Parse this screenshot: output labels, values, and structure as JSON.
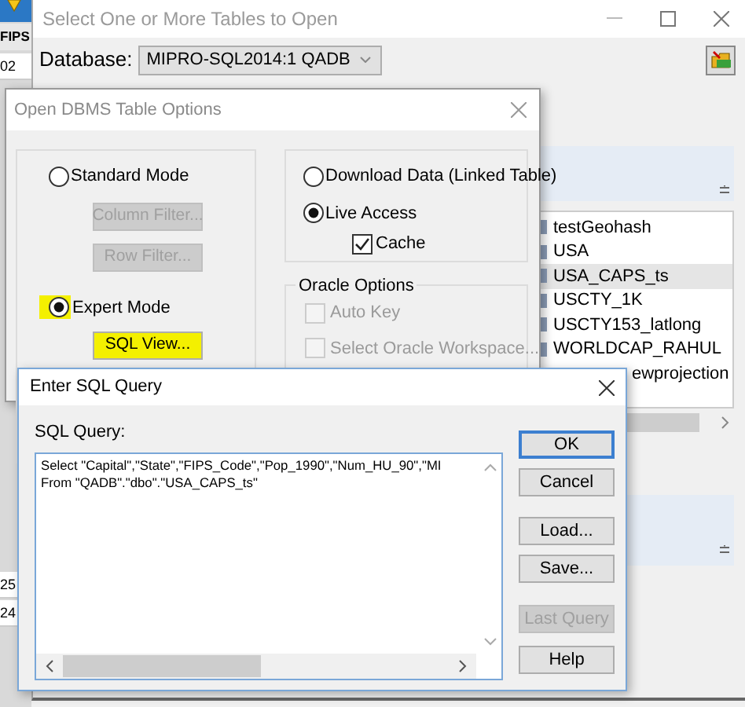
{
  "background_app": {
    "column_header": "FIPS",
    "cells": [
      "02",
      "25",
      "24"
    ]
  },
  "tables_window": {
    "title": "Select One or More Tables to Open",
    "database_label": "Database:",
    "database": "MIPRO-SQL2014:1 QADB",
    "tables": [
      {
        "name": "testGeohash",
        "selected": false
      },
      {
        "name": "USA",
        "selected": false
      },
      {
        "name": "USA_CAPS_ts",
        "selected": true
      },
      {
        "name": "USCTY_1K",
        "selected": false
      },
      {
        "name": "USCTY153_latlong",
        "selected": false
      },
      {
        "name": "WORLDCAP_RAHUL",
        "selected": false
      },
      {
        "name": "ewprojection",
        "selected": false,
        "kind": "covered"
      }
    ]
  },
  "options_dialog": {
    "title": "Open DBMS Table Options",
    "modes": [
      {
        "label": "Standard Mode",
        "selected": false,
        "highlighted": false
      },
      {
        "label": "Expert Mode",
        "selected": true,
        "highlighted": true
      }
    ],
    "mode_buttons": [
      {
        "label": "Column Filter...",
        "disabled": true,
        "highlighted": false
      },
      {
        "label": "Row Filter...",
        "disabled": true,
        "highlighted": false
      },
      {
        "label": "SQL View...",
        "disabled": false,
        "highlighted": true
      }
    ],
    "access": [
      {
        "label": "Download Data (Linked Table)",
        "selected": false
      },
      {
        "label": "Live Access",
        "selected": true
      }
    ],
    "cache": {
      "label": "Cache",
      "checked": true
    },
    "oracle_options": {
      "title": "Oracle Options",
      "items": [
        {
          "label": "Auto Key",
          "checked": false,
          "disabled": true
        },
        {
          "label": "Select Oracle Workspace...",
          "checked": false,
          "disabled": true
        }
      ]
    }
  },
  "sql_dialog": {
    "title": "Enter SQL Query",
    "label": "SQL Query:",
    "query": "Select \"Capital\",\"State\",\"FIPS_Code\",\"Pop_1990\",\"Num_HU_90\",\"MI\nFrom \"QADB\".\"dbo\".\"USA_CAPS_ts\"",
    "buttons": [
      {
        "label": "OK",
        "default": true,
        "disabled": false
      },
      {
        "label": "Cancel",
        "default": false,
        "disabled": false
      },
      {
        "label": "Load...",
        "default": false,
        "disabled": false
      },
      {
        "label": "Save...",
        "default": false,
        "disabled": false
      },
      {
        "label": "Last Query",
        "default": false,
        "disabled": true
      },
      {
        "label": "Help",
        "default": false,
        "disabled": false
      }
    ]
  }
}
